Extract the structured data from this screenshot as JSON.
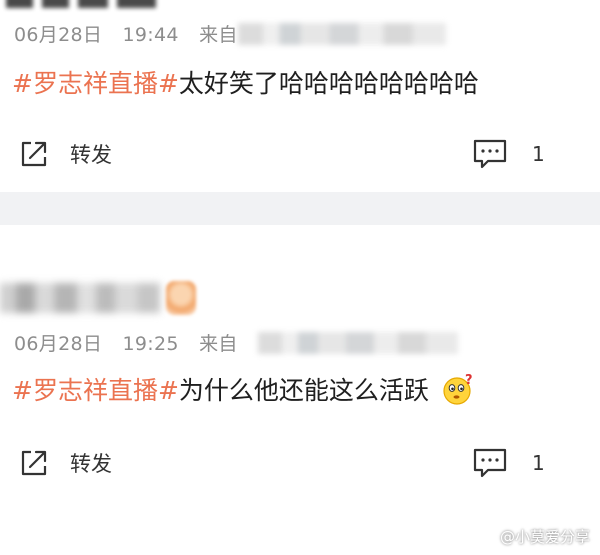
{
  "posts": [
    {
      "date": "06月28日",
      "time": "19:44",
      "from_label": "来自",
      "hashtag": "#罗志祥直播#",
      "text": "太好笑了哈哈哈哈哈哈哈哈",
      "repost_label": "转发",
      "comment_count": "1"
    },
    {
      "date": "06月28日",
      "time": "19:25",
      "from_label": "来自",
      "hashtag": "#罗志祥直播#",
      "text": "为什么他还能这么活跃",
      "emoji": "thinking-emoji",
      "repost_label": "转发",
      "comment_count": "1"
    }
  ],
  "watermark": {
    "text": "@小莫爱分享"
  },
  "colors": {
    "hashtag": "#eb7350",
    "meta": "#8d8d8d",
    "separator": "#f1f2f4"
  },
  "icons": {
    "repost": "repost-arrow-icon",
    "comment": "comment-icon",
    "watermark": "watermark-logo-icon"
  }
}
